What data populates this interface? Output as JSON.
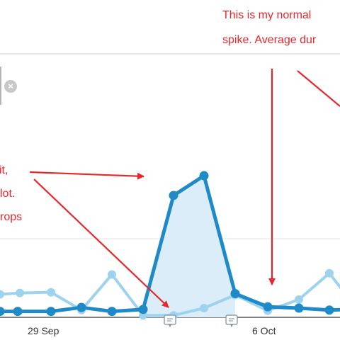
{
  "annotations": {
    "top_line1": "This is my normal",
    "top_line2": "spike. Average dur",
    "left_line1": "it,",
    "left_line2": "lot.",
    "left_line3": "rops"
  },
  "close_button": {
    "icon": "close-icon",
    "glyph": "×"
  },
  "colors": {
    "series_dark": "#1e8ac7",
    "series_light": "#9ed3ef",
    "area_fill": "#dbedf8",
    "annotation_red": "#e8262b"
  },
  "chart_data": {
    "type": "line",
    "x_tick_labels": [
      "29 Sep",
      "6 Oct"
    ],
    "series": [
      {
        "color": "#1e8ac7",
        "values": [
          0.9,
          0.9,
          0.9,
          1.5,
          0.9,
          1.2,
          18.5,
          21.5,
          3.6,
          1.6,
          1.4,
          1.1,
          1.2,
          1.2,
          1.0
        ]
      },
      {
        "color": "#9ed3ef",
        "values": [
          3.5,
          3.7,
          3.8,
          1.1,
          6.5,
          0.3,
          0.3,
          1.4,
          3.4,
          1.0,
          2.7,
          6.7,
          2.5
        ]
      }
    ],
    "event_markers": 2
  }
}
